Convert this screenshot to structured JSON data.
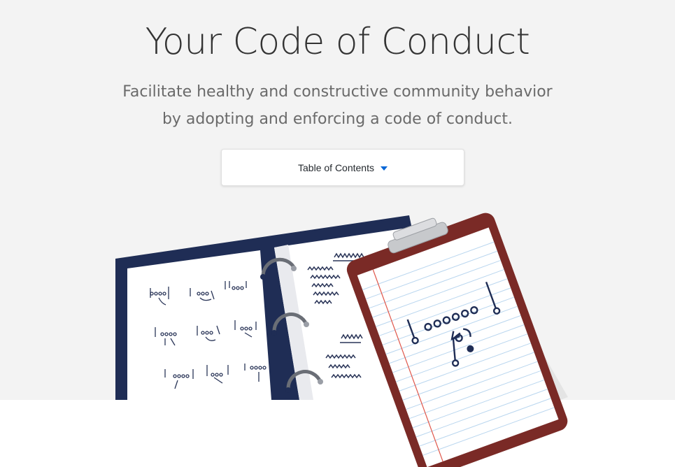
{
  "hero": {
    "title": "Your Code of Conduct",
    "subtitle": "Facilitate healthy and constructive community behavior by adopting and enforcing a code of conduct."
  },
  "toc": {
    "label": "Table of Contents",
    "icon": "caret-down-icon"
  },
  "illustration": {
    "items": [
      "playbook-binder",
      "clipboard"
    ]
  },
  "colors": {
    "background": "#f3f3f3",
    "title": "#333333",
    "subtitle": "#6a6a6a",
    "caret": "#0366d6",
    "binder": "#1f2d55",
    "clipboard": "#7a2a26"
  }
}
